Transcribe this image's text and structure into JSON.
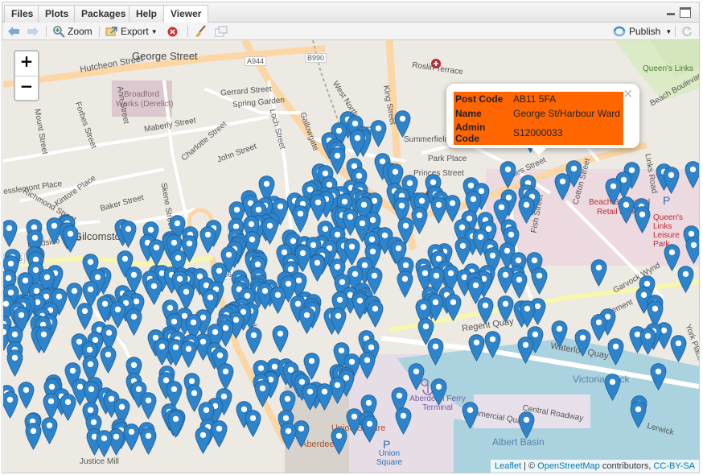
{
  "tabs": [
    {
      "label": "Files",
      "active": false
    },
    {
      "label": "Plots",
      "active": false
    },
    {
      "label": "Packages",
      "active": false
    },
    {
      "label": "Help",
      "active": false
    },
    {
      "label": "Viewer",
      "active": true
    }
  ],
  "toolbar": {
    "zoom_label": "Zoom",
    "export_label": "Export",
    "publish_label": "Publish"
  },
  "map": {
    "zoom_in": "+",
    "zoom_out": "−",
    "marker_color": "#2e84cb",
    "street_labels": {
      "george_street": "George Street",
      "a944": "A944",
      "b990": "B990",
      "hutcheon_street": "Hutcheon Street",
      "broadford": "Broadford",
      "works": "Works (Derelict)",
      "gerrard_street": "Gerrard Street",
      "spring_garden": "Spring Garden",
      "maberly_street": "Maberly Street",
      "charlotte_street": "Charlotte Street",
      "west_north_street": "West North Street",
      "king_street": "King Street",
      "gallowgate": "Gallowgate",
      "john_street": "John Street",
      "loch_street": "Loch Street",
      "jopps_lane": "Jopp's Lane",
      "baker_street": "Baker Street",
      "skene_street": "Skene Street",
      "kintore_place": "Kintore Place",
      "richmond_street": "Richmond Street",
      "esslemont_place": "esslemont Place",
      "gilcomston": "Gilcomston",
      "leadside_road": "Leadside Road",
      "b985": "B985",
      "b986": "B986",
      "denburn_road": "Denburn Road",
      "princes_street": "Princes Street",
      "park_place": "Park Place",
      "summerfield": "Summerfield",
      "roslin_terrace": "Roslin Terrace",
      "wales_street": "Wales Street",
      "links_road": "Links Road",
      "beach_boulevard": "Beach Boulevard",
      "retail_park": "Retail Park",
      "queens_links": "Queen's Links",
      "beach_boulevard_2": "Beach Boulevard",
      "queens_links_leisure": "Queen's Links Leisure Park",
      "virginia_street": "Virginia Street",
      "regent_quay": "Regent Quay",
      "waterloo_quay": "Waterloo Quay",
      "victoria_dock": "Victoria Dock",
      "commercial_quay": "Commercial Quay",
      "central_roadway": "Central Roadway",
      "aberdeen_ferry_terminal": "Aberdeen Ferry Terminal",
      "union_square": "Union Square",
      "albert_basin": "Albert Basin",
      "justice_mill": "Justice Mill",
      "garvock_wynd": "Garvock Wynd",
      "st_clement": "St Clement",
      "york_place": "York Place",
      "mount_street": "Mount Street",
      "forbes_street": "Forbes Street",
      "ann_street": "Ann Street",
      "fish_street": "Fish Street",
      "cotton_street": "Cotton Street",
      "lerwick": "Lerwick",
      "aberdeen": "Aberdeen"
    }
  },
  "popup": {
    "close": "×",
    "rows": [
      {
        "key": "Post Code",
        "value": "AB11 5FA"
      },
      {
        "key": "Name",
        "value": "George St/Harbour Ward"
      },
      {
        "key": "Admin Code",
        "value": "S12000033"
      }
    ],
    "highlight_color": "#ff6600"
  },
  "attribution": {
    "leaflet": "Leaflet",
    "sep": " | © ",
    "osm": "OpenStreetMap",
    "contrib": " contributors, ",
    "license": "CC-BY-SA"
  }
}
